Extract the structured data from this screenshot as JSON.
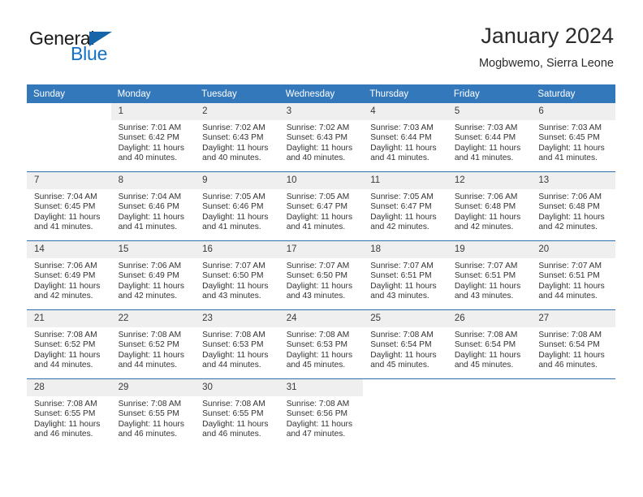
{
  "brand": {
    "name_part1": "General",
    "name_part2": "Blue",
    "accent_color": "#1271c4",
    "triangle_color": "#1565a8"
  },
  "header": {
    "title": "January 2024",
    "location": "Mogbwemo, Sierra Leone"
  },
  "calendar": {
    "header_bg": "#3478bc",
    "daynum_bg": "#efefef",
    "weekday_headers": [
      "Sunday",
      "Monday",
      "Tuesday",
      "Wednesday",
      "Thursday",
      "Friday",
      "Saturday"
    ],
    "weeks": [
      [
        {
          "day": "",
          "sunrise": "",
          "sunset": "",
          "daylight_line1": "",
          "daylight_line2": ""
        },
        {
          "day": "1",
          "sunrise": "Sunrise: 7:01 AM",
          "sunset": "Sunset: 6:42 PM",
          "daylight_line1": "Daylight: 11 hours",
          "daylight_line2": "and 40 minutes."
        },
        {
          "day": "2",
          "sunrise": "Sunrise: 7:02 AM",
          "sunset": "Sunset: 6:43 PM",
          "daylight_line1": "Daylight: 11 hours",
          "daylight_line2": "and 40 minutes."
        },
        {
          "day": "3",
          "sunrise": "Sunrise: 7:02 AM",
          "sunset": "Sunset: 6:43 PM",
          "daylight_line1": "Daylight: 11 hours",
          "daylight_line2": "and 40 minutes."
        },
        {
          "day": "4",
          "sunrise": "Sunrise: 7:03 AM",
          "sunset": "Sunset: 6:44 PM",
          "daylight_line1": "Daylight: 11 hours",
          "daylight_line2": "and 41 minutes."
        },
        {
          "day": "5",
          "sunrise": "Sunrise: 7:03 AM",
          "sunset": "Sunset: 6:44 PM",
          "daylight_line1": "Daylight: 11 hours",
          "daylight_line2": "and 41 minutes."
        },
        {
          "day": "6",
          "sunrise": "Sunrise: 7:03 AM",
          "sunset": "Sunset: 6:45 PM",
          "daylight_line1": "Daylight: 11 hours",
          "daylight_line2": "and 41 minutes."
        }
      ],
      [
        {
          "day": "7",
          "sunrise": "Sunrise: 7:04 AM",
          "sunset": "Sunset: 6:45 PM",
          "daylight_line1": "Daylight: 11 hours",
          "daylight_line2": "and 41 minutes."
        },
        {
          "day": "8",
          "sunrise": "Sunrise: 7:04 AM",
          "sunset": "Sunset: 6:46 PM",
          "daylight_line1": "Daylight: 11 hours",
          "daylight_line2": "and 41 minutes."
        },
        {
          "day": "9",
          "sunrise": "Sunrise: 7:05 AM",
          "sunset": "Sunset: 6:46 PM",
          "daylight_line1": "Daylight: 11 hours",
          "daylight_line2": "and 41 minutes."
        },
        {
          "day": "10",
          "sunrise": "Sunrise: 7:05 AM",
          "sunset": "Sunset: 6:47 PM",
          "daylight_line1": "Daylight: 11 hours",
          "daylight_line2": "and 41 minutes."
        },
        {
          "day": "11",
          "sunrise": "Sunrise: 7:05 AM",
          "sunset": "Sunset: 6:47 PM",
          "daylight_line1": "Daylight: 11 hours",
          "daylight_line2": "and 42 minutes."
        },
        {
          "day": "12",
          "sunrise": "Sunrise: 7:06 AM",
          "sunset": "Sunset: 6:48 PM",
          "daylight_line1": "Daylight: 11 hours",
          "daylight_line2": "and 42 minutes."
        },
        {
          "day": "13",
          "sunrise": "Sunrise: 7:06 AM",
          "sunset": "Sunset: 6:48 PM",
          "daylight_line1": "Daylight: 11 hours",
          "daylight_line2": "and 42 minutes."
        }
      ],
      [
        {
          "day": "14",
          "sunrise": "Sunrise: 7:06 AM",
          "sunset": "Sunset: 6:49 PM",
          "daylight_line1": "Daylight: 11 hours",
          "daylight_line2": "and 42 minutes."
        },
        {
          "day": "15",
          "sunrise": "Sunrise: 7:06 AM",
          "sunset": "Sunset: 6:49 PM",
          "daylight_line1": "Daylight: 11 hours",
          "daylight_line2": "and 42 minutes."
        },
        {
          "day": "16",
          "sunrise": "Sunrise: 7:07 AM",
          "sunset": "Sunset: 6:50 PM",
          "daylight_line1": "Daylight: 11 hours",
          "daylight_line2": "and 43 minutes."
        },
        {
          "day": "17",
          "sunrise": "Sunrise: 7:07 AM",
          "sunset": "Sunset: 6:50 PM",
          "daylight_line1": "Daylight: 11 hours",
          "daylight_line2": "and 43 minutes."
        },
        {
          "day": "18",
          "sunrise": "Sunrise: 7:07 AM",
          "sunset": "Sunset: 6:51 PM",
          "daylight_line1": "Daylight: 11 hours",
          "daylight_line2": "and 43 minutes."
        },
        {
          "day": "19",
          "sunrise": "Sunrise: 7:07 AM",
          "sunset": "Sunset: 6:51 PM",
          "daylight_line1": "Daylight: 11 hours",
          "daylight_line2": "and 43 minutes."
        },
        {
          "day": "20",
          "sunrise": "Sunrise: 7:07 AM",
          "sunset": "Sunset: 6:51 PM",
          "daylight_line1": "Daylight: 11 hours",
          "daylight_line2": "and 44 minutes."
        }
      ],
      [
        {
          "day": "21",
          "sunrise": "Sunrise: 7:08 AM",
          "sunset": "Sunset: 6:52 PM",
          "daylight_line1": "Daylight: 11 hours",
          "daylight_line2": "and 44 minutes."
        },
        {
          "day": "22",
          "sunrise": "Sunrise: 7:08 AM",
          "sunset": "Sunset: 6:52 PM",
          "daylight_line1": "Daylight: 11 hours",
          "daylight_line2": "and 44 minutes."
        },
        {
          "day": "23",
          "sunrise": "Sunrise: 7:08 AM",
          "sunset": "Sunset: 6:53 PM",
          "daylight_line1": "Daylight: 11 hours",
          "daylight_line2": "and 44 minutes."
        },
        {
          "day": "24",
          "sunrise": "Sunrise: 7:08 AM",
          "sunset": "Sunset: 6:53 PM",
          "daylight_line1": "Daylight: 11 hours",
          "daylight_line2": "and 45 minutes."
        },
        {
          "day": "25",
          "sunrise": "Sunrise: 7:08 AM",
          "sunset": "Sunset: 6:54 PM",
          "daylight_line1": "Daylight: 11 hours",
          "daylight_line2": "and 45 minutes."
        },
        {
          "day": "26",
          "sunrise": "Sunrise: 7:08 AM",
          "sunset": "Sunset: 6:54 PM",
          "daylight_line1": "Daylight: 11 hours",
          "daylight_line2": "and 45 minutes."
        },
        {
          "day": "27",
          "sunrise": "Sunrise: 7:08 AM",
          "sunset": "Sunset: 6:54 PM",
          "daylight_line1": "Daylight: 11 hours",
          "daylight_line2": "and 46 minutes."
        }
      ],
      [
        {
          "day": "28",
          "sunrise": "Sunrise: 7:08 AM",
          "sunset": "Sunset: 6:55 PM",
          "daylight_line1": "Daylight: 11 hours",
          "daylight_line2": "and 46 minutes."
        },
        {
          "day": "29",
          "sunrise": "Sunrise: 7:08 AM",
          "sunset": "Sunset: 6:55 PM",
          "daylight_line1": "Daylight: 11 hours",
          "daylight_line2": "and 46 minutes."
        },
        {
          "day": "30",
          "sunrise": "Sunrise: 7:08 AM",
          "sunset": "Sunset: 6:55 PM",
          "daylight_line1": "Daylight: 11 hours",
          "daylight_line2": "and 46 minutes."
        },
        {
          "day": "31",
          "sunrise": "Sunrise: 7:08 AM",
          "sunset": "Sunset: 6:56 PM",
          "daylight_line1": "Daylight: 11 hours",
          "daylight_line2": "and 47 minutes."
        },
        {
          "day": "",
          "sunrise": "",
          "sunset": "",
          "daylight_line1": "",
          "daylight_line2": ""
        },
        {
          "day": "",
          "sunrise": "",
          "sunset": "",
          "daylight_line1": "",
          "daylight_line2": ""
        },
        {
          "day": "",
          "sunrise": "",
          "sunset": "",
          "daylight_line1": "",
          "daylight_line2": ""
        }
      ]
    ]
  }
}
